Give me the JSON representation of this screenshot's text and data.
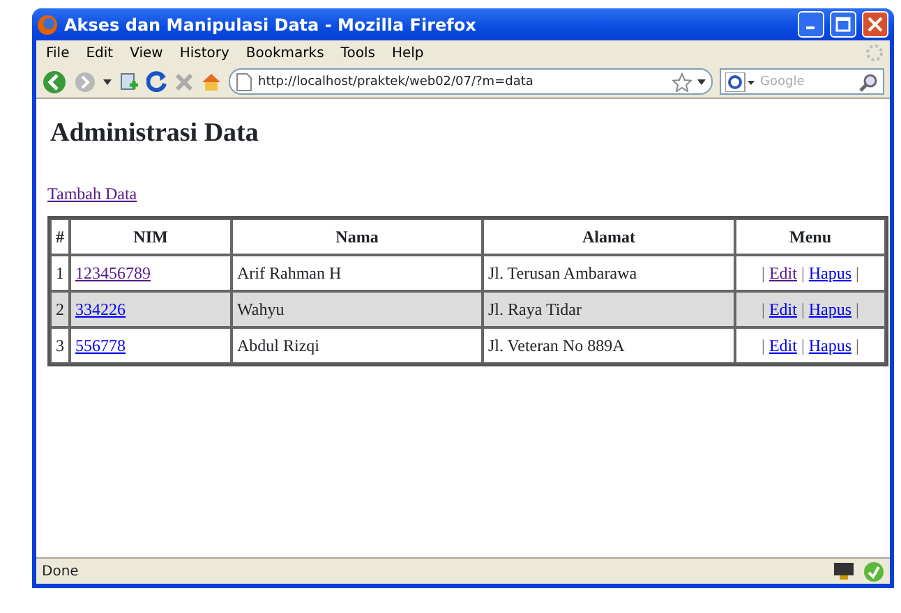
{
  "window": {
    "title": "Akses dan Manipulasi Data - Mozilla Firefox"
  },
  "menu_bar": [
    "File",
    "Edit",
    "View",
    "History",
    "Bookmarks",
    "Tools",
    "Help"
  ],
  "toolbar": {
    "url": "http://localhost/praktek/web02/07/?m=data",
    "search_placeholder": "Google"
  },
  "page": {
    "heading": "Administrasi Data",
    "add_link": {
      "text": "Tambah Data",
      "visited": true
    }
  },
  "table": {
    "columns": [
      "#",
      "NIM",
      "Nama",
      "Alamat",
      "Menu"
    ],
    "rows": [
      {
        "selected": false,
        "number": "1",
        "nim": {
          "text": "123456789",
          "visited": true
        },
        "nama": "Arif Rahman H",
        "alamat": "Jl. Terusan Ambarawa",
        "menu": [
          {
            "kind": "separator",
            "text": "|"
          },
          {
            "kind": "link",
            "text": "Edit",
            "visited": true
          },
          {
            "kind": "separator",
            "text": "|"
          },
          {
            "kind": "link",
            "text": "Hapus",
            "visited": false
          },
          {
            "kind": "separator",
            "text": "|"
          }
        ]
      },
      {
        "selected": true,
        "number": "2",
        "nim": {
          "text": "334226",
          "visited": false
        },
        "nama": "Wahyu",
        "alamat": "Jl. Raya Tidar",
        "menu": [
          {
            "kind": "separator",
            "text": "|"
          },
          {
            "kind": "link",
            "text": "Edit",
            "visited": false
          },
          {
            "kind": "separator",
            "text": "|"
          },
          {
            "kind": "link",
            "text": "Hapus",
            "visited": false
          },
          {
            "kind": "separator",
            "text": "|"
          }
        ]
      },
      {
        "selected": false,
        "number": "3",
        "nim": {
          "text": "556778",
          "visited": false
        },
        "nama": "Abdul Rizqi",
        "alamat": "Jl. Veteran No 889A",
        "menu": [
          {
            "kind": "separator",
            "text": "|"
          },
          {
            "kind": "link",
            "text": "Edit",
            "visited": false
          },
          {
            "kind": "separator",
            "text": "|"
          },
          {
            "kind": "link",
            "text": "Hapus",
            "visited": false
          },
          {
            "kind": "separator",
            "text": "|"
          }
        ]
      }
    ]
  },
  "status_bar": {
    "text": "Done"
  }
}
